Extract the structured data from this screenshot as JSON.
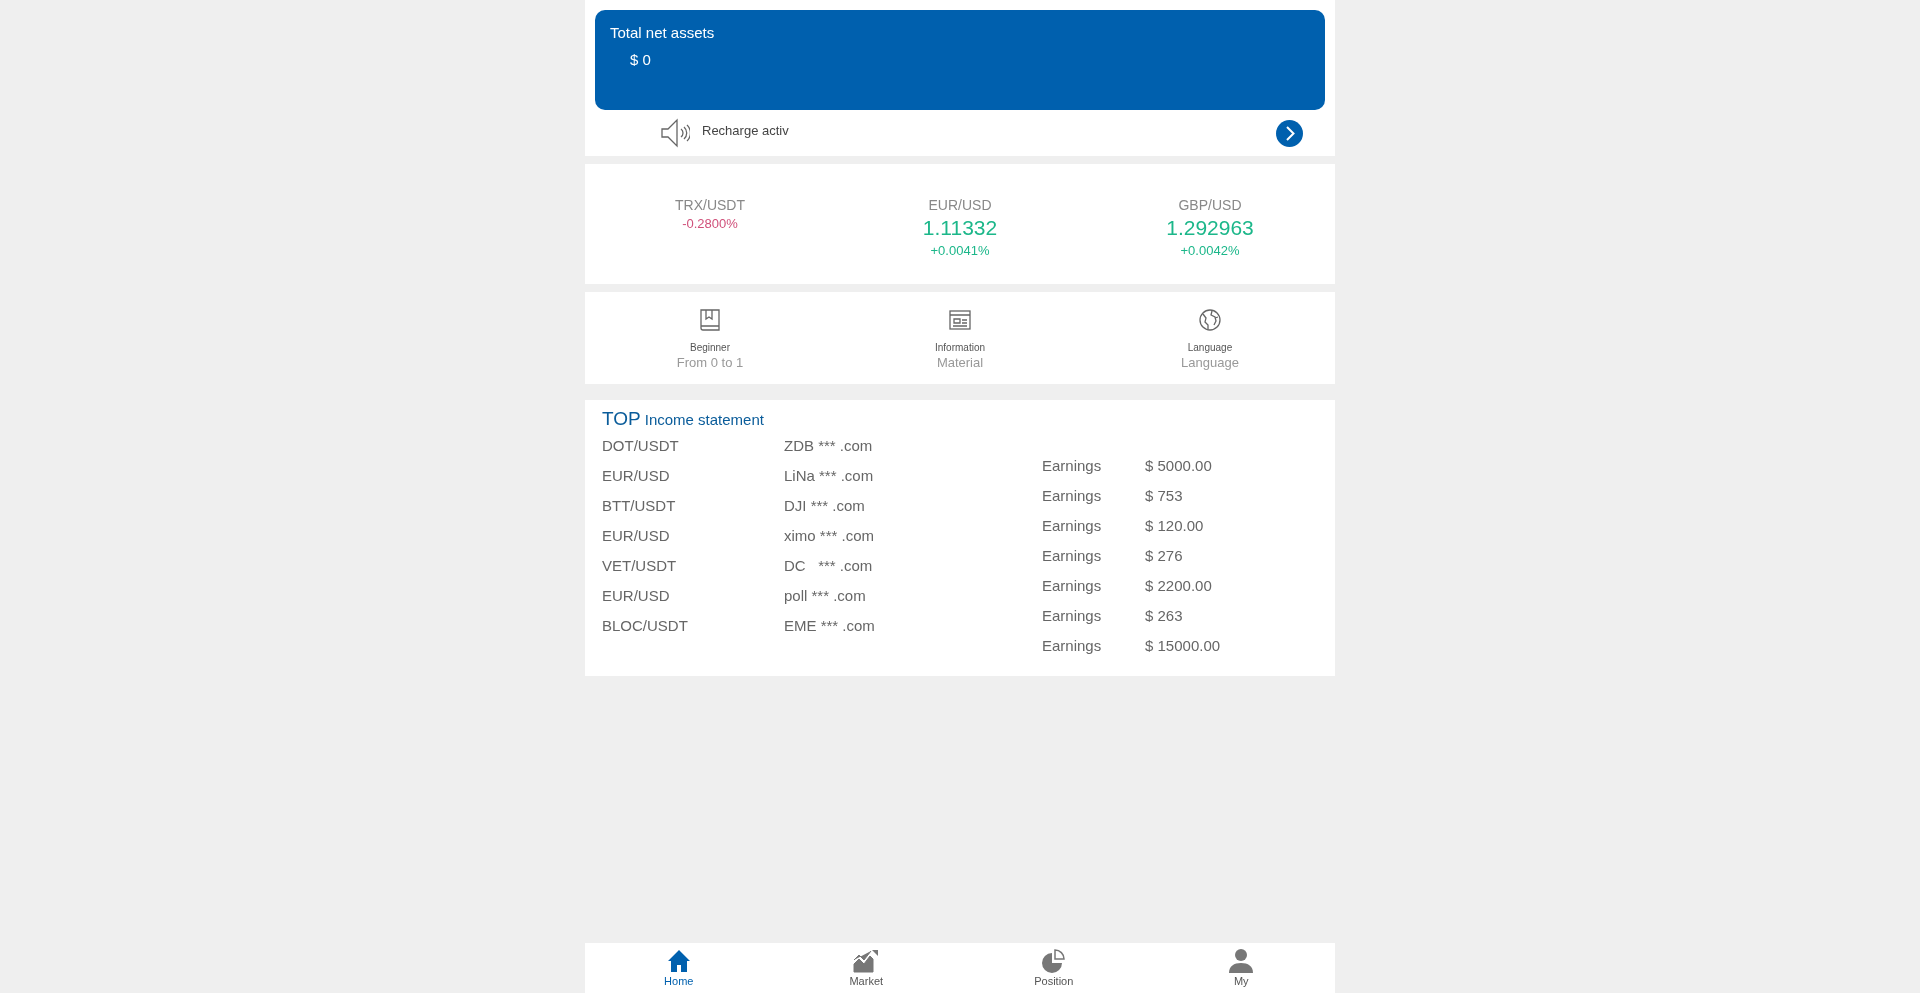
{
  "assets": {
    "title": "Total net assets",
    "value": "$ 0"
  },
  "notice": {
    "text": "Recharge activ"
  },
  "tickers": [
    {
      "pair": "TRX/USDT",
      "change": "-0.2800%",
      "color": "#d0507a"
    },
    {
      "pair": "EUR/USD",
      "price": "1.11332",
      "change": "+0.0041%",
      "color": "#1cb78a"
    },
    {
      "pair": "GBP/USD",
      "price": "1.292963",
      "change": "+0.0042%",
      "color": "#1cb78a"
    }
  ],
  "shortcuts": [
    {
      "kind": "book",
      "title": "Beginner",
      "subtitle": "From 0 to 1"
    },
    {
      "kind": "news",
      "title": "Information",
      "subtitle": "Material"
    },
    {
      "kind": "globe",
      "title": "Language",
      "subtitle": "Language"
    }
  ],
  "income": {
    "title_prefix": "TOP",
    "title": "Income statement",
    "trades": [
      {
        "pair": "DOT/USDT",
        "user": "ZDB *** .com"
      },
      {
        "pair": "EUR/USD",
        "user": "LiNa *** .com"
      },
      {
        "pair": "BTT/USDT",
        "user": "DJI *** .com"
      },
      {
        "pair": "EUR/USD",
        "user": "ximo *** .com"
      },
      {
        "pair": "VET/USDT",
        "user": "DC   *** .com"
      },
      {
        "pair": "EUR/USD",
        "user": "poll *** .com"
      },
      {
        "pair": "BLOC/USDT",
        "user": "EME *** .com"
      }
    ],
    "earnings": [
      {
        "label": "Earnings",
        "amount": "$ 5000.00"
      },
      {
        "label": "Earnings",
        "amount": "$ 753"
      },
      {
        "label": "Earnings",
        "amount": "$ 120.00"
      },
      {
        "label": "Earnings",
        "amount": "$ 276"
      },
      {
        "label": "Earnings",
        "amount": "$ 2200.00"
      },
      {
        "label": "Earnings",
        "amount": "$ 263"
      },
      {
        "label": "Earnings",
        "amount": "$ 15000.00"
      }
    ]
  },
  "nav": [
    {
      "kind": "home",
      "label": "Home",
      "selected": true
    },
    {
      "kind": "market",
      "label": "Market",
      "selected": false
    },
    {
      "kind": "position",
      "label": "Position",
      "selected": false
    },
    {
      "kind": "user",
      "label": "My",
      "selected": false
    }
  ]
}
